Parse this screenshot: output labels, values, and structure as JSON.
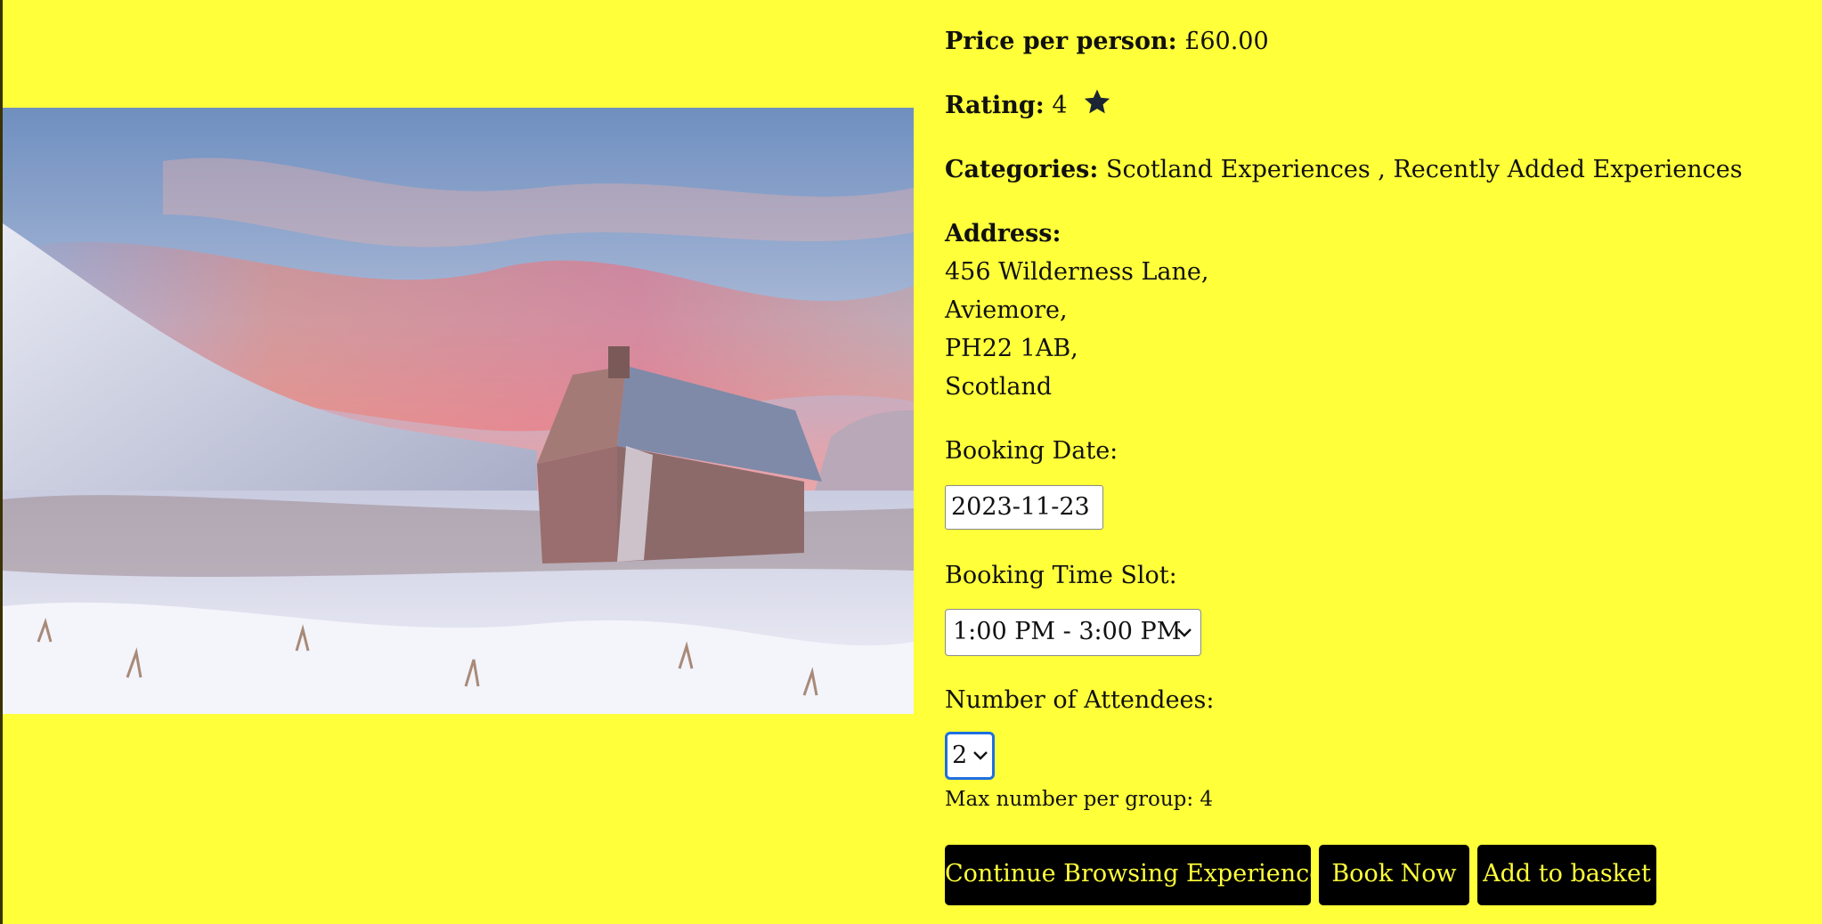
{
  "experience": {
    "price_label": "Price per person:",
    "price_value": "£60.00",
    "rating_label": "Rating:",
    "rating_value": "4",
    "categories_label": "Categories:",
    "categories_value": "Scotland Experiences , Recently Added Experiences",
    "address_label": "Address:",
    "address_lines": [
      "456 Wilderness Lane,",
      "Aviemore,",
      "PH22 1AB,",
      "Scotland"
    ]
  },
  "booking": {
    "date_label": "Booking Date:",
    "date_value": "2023-11-23",
    "time_label": "Booking Time Slot:",
    "time_value": "1:00 PM - 3:00 PM",
    "attendees_label": "Number of Attendees:",
    "attendees_value": "2",
    "max_note": "Max number per group: 4"
  },
  "actions": {
    "continue_label": "Continue Browsing Experiences",
    "book_label": "Book Now",
    "basket_label": "Add to basket"
  },
  "icons": {
    "rating": "star-icon",
    "select_arrow": "chevron-down-icon"
  },
  "colors": {
    "background": "#ffff3a",
    "button_bg": "#000000",
    "button_text": "#ffff3a",
    "focus_ring": "#1f6fe0"
  }
}
